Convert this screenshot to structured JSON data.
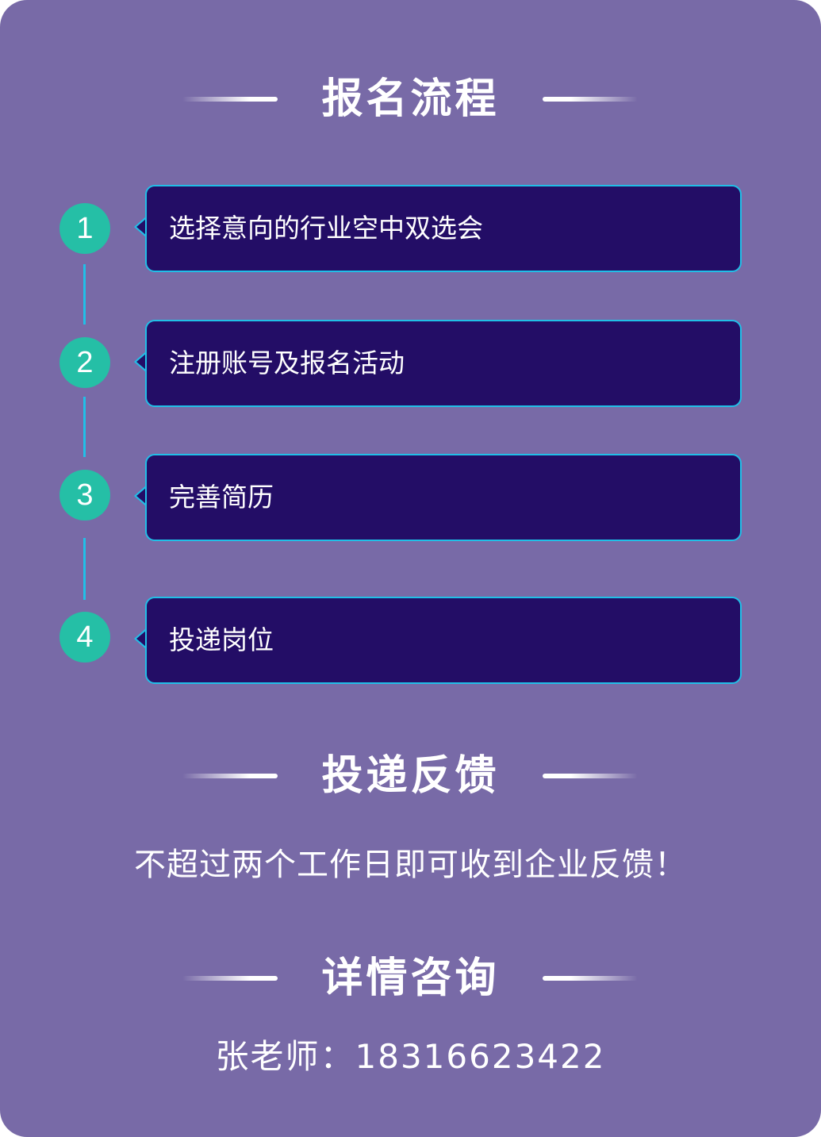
{
  "colors": {
    "background": "#786aa7",
    "step_box": "#230d66",
    "step_border": "#21bfe7",
    "step_number": "#25bfa6",
    "text": "#ffffff"
  },
  "registration": {
    "title": "报名流程",
    "steps": [
      {
        "number": "1",
        "label": "选择意向的行业空中双选会"
      },
      {
        "number": "2",
        "label": "注册账号及报名活动"
      },
      {
        "number": "3",
        "label": "完善简历"
      },
      {
        "number": "4",
        "label": "投递岗位"
      }
    ]
  },
  "feedback": {
    "title": "投递反馈",
    "text": "不超过两个工作日即可收到企业反馈！"
  },
  "consult": {
    "title": "详情咨询",
    "contact": "张老师：18316623422"
  }
}
